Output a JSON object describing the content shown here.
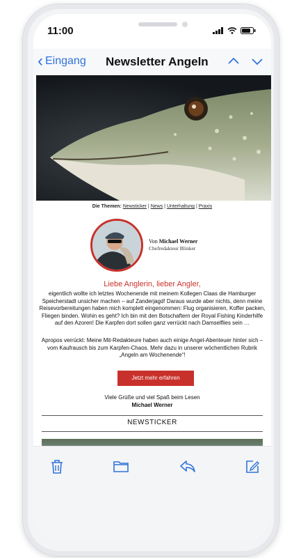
{
  "status": {
    "time": "11:00"
  },
  "nav": {
    "back_label": "Eingang",
    "title": "Newsletter Angeln"
  },
  "topics": {
    "prefix": "Die Themen:",
    "items": [
      "Newsticker",
      "News",
      "Unterhaltung",
      "Praxis"
    ],
    "sep": " | "
  },
  "author": {
    "by": "Von",
    "name": "Michael Werner",
    "role": "Chefredakteur Blinker"
  },
  "greeting": "Liebe Anglerin, lieber Angler,",
  "paragraph1": "eigentlich wollte ich letztes Wochenende mit meinem Kollegen Claas die Hamburger Speicherstadt unsicher machen – auf Zanderjagd! Daraus wurde aber nichts, denn meine Reisevorbereitungen haben mich komplett eingenommen: Flug organisieren, Koffer packen, Fliegen binden. Wohin es geht? Ich bin mit den Botschaftern der Royal Fishing Kinderhilfe auf den Azoren! Die Karpfen dort sollen ganz verrückt nach Damselflies sein …",
  "paragraph2": "Apropos verrückt: Meine Mit-Redakteure haben auch einige Angel-Abenteuer hinter sich – vom Kaufrausch bis zum Karpfen-Chaos. Mehr dazu in unserer wöchentlichen Rubrik „Angeln am Wochenende“!",
  "cta_label": "Jetzt mehr erfahren",
  "signoff": {
    "line": "Viele Grüße und viel Spaß beim Lesen",
    "name": "Michael Werner"
  },
  "section_title": "NEWSTICKER",
  "colors": {
    "accent": "#c8312b",
    "link": "#2f73d9"
  },
  "toolbar": {
    "icons": [
      "trash-icon",
      "folder-icon",
      "reply-icon",
      "compose-icon"
    ]
  }
}
